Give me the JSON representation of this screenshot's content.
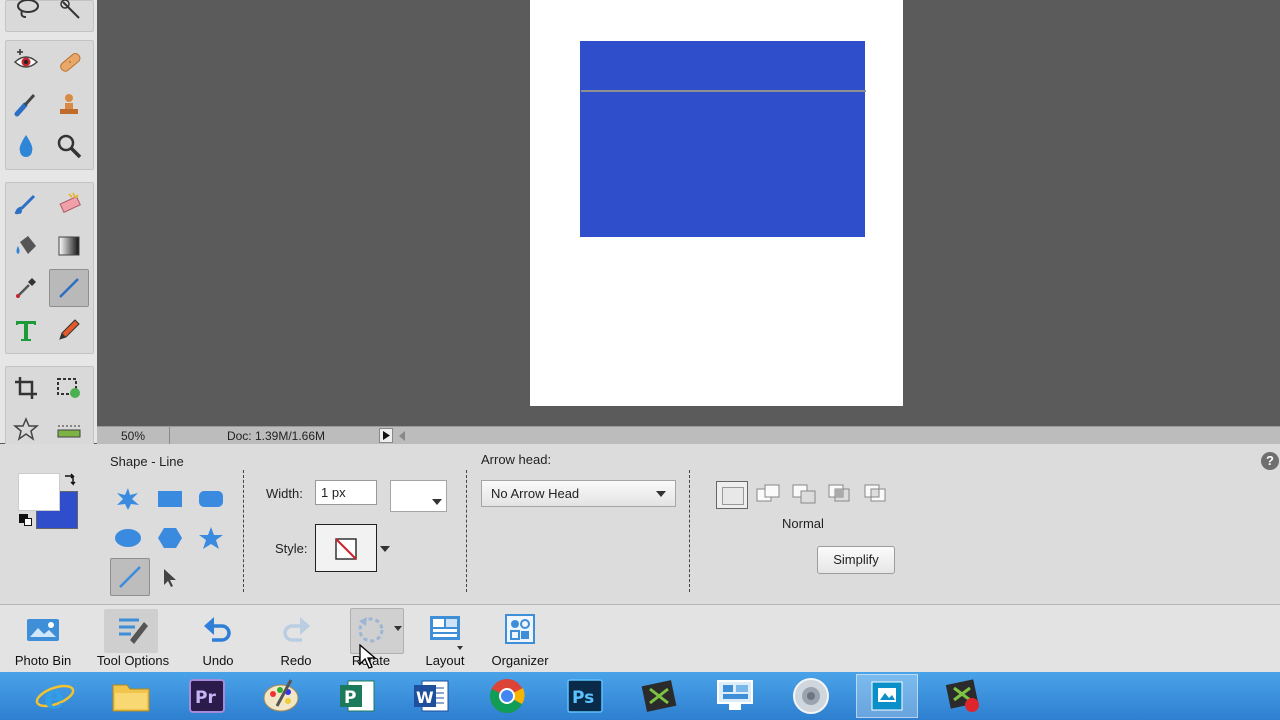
{
  "status": {
    "zoom": "50%",
    "doc_size": "Doc: 1.39M/1.66M"
  },
  "options": {
    "title": "Shape - Line",
    "width_label": "Width:",
    "width_value": "1 px",
    "style_label": "Style:",
    "arrow_head_label": "Arrow head:",
    "arrow_head_value": "No Arrow Head",
    "mode_label": "Normal",
    "simplify_label": "Simplify",
    "help_glyph": "?"
  },
  "panel": {
    "photo_bin": "Photo Bin",
    "tool_options": "Tool Options",
    "undo": "Undo",
    "redo": "Redo",
    "rotate": "Rotate",
    "layout": "Layout",
    "organizer": "Organizer"
  },
  "taskbar": {
    "apps": [
      "internet-explorer-icon",
      "file-explorer-icon",
      "premiere-icon",
      "paint-icon",
      "publisher-icon",
      "word-icon",
      "chrome-icon",
      "photoshop-icon",
      "camtasia-icon",
      "remote-desktop-icon",
      "speaker-icon",
      "photoshop-elements-icon",
      "recorder-icon"
    ]
  },
  "colors": {
    "canvas_shape": "#2f4ecb",
    "foreground": "#ffffff",
    "background_swatch": "#2f4ecb",
    "workspace": "#5b5b5b"
  }
}
